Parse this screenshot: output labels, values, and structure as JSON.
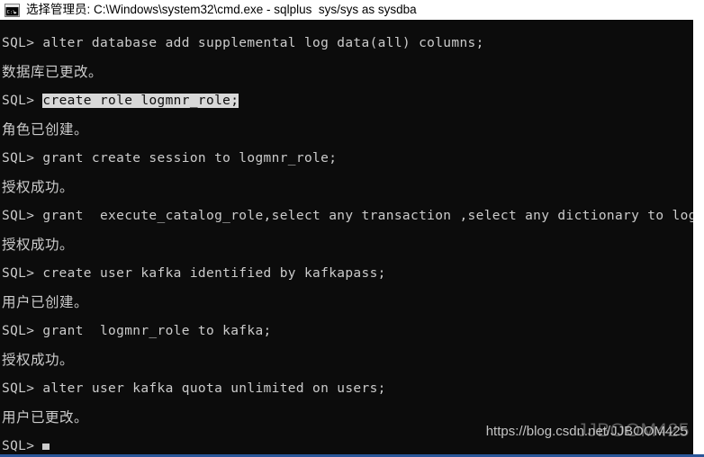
{
  "window": {
    "icon": "cmd-console-icon",
    "title": "选择管理员: C:\\Windows\\system32\\cmd.exe - sqlplus  sys/sys as sysdba",
    "background_color": "#0c0c0c",
    "foreground_color": "#cccccc",
    "titlebar_color": "#ffffff",
    "selection_background": "#d8d8d8",
    "selection_foreground": "#0c0c0c",
    "accent_color": "#2a5699"
  },
  "console": {
    "lines": [
      {
        "id": "l1",
        "kind": "command",
        "text": "SQL> alter database add supplemental log data(all) columns;"
      },
      {
        "id": "l2",
        "kind": "output",
        "text": "数据库已更改。"
      },
      {
        "id": "l3",
        "kind": "command",
        "prompt": "SQL> ",
        "selected": "create role logmnr_role;"
      },
      {
        "id": "l4",
        "kind": "output",
        "text": "角色已创建。"
      },
      {
        "id": "l5",
        "kind": "command",
        "text": "SQL> grant create session to logmnr_role;"
      },
      {
        "id": "l6",
        "kind": "output",
        "text": "授权成功。"
      },
      {
        "id": "l7",
        "kind": "command",
        "text": "SQL> grant  execute_catalog_role,select any transaction ,select any dictionary to logmnr_role;"
      },
      {
        "id": "l8",
        "kind": "output",
        "text": "授权成功。"
      },
      {
        "id": "l9",
        "kind": "command",
        "text": "SQL> create user kafka identified by kafkapass;"
      },
      {
        "id": "l10",
        "kind": "output",
        "text": "用户已创建。"
      },
      {
        "id": "l11",
        "kind": "command",
        "text": "SQL> grant  logmnr_role to kafka;"
      },
      {
        "id": "l12",
        "kind": "output",
        "text": "授权成功。"
      },
      {
        "id": "l13",
        "kind": "command",
        "text": "SQL> alter user kafka quota unlimited on users;"
      },
      {
        "id": "l14",
        "kind": "output",
        "text": "用户已更改。"
      },
      {
        "id": "l15",
        "kind": "prompt",
        "text": "SQL> "
      }
    ]
  },
  "watermark": {
    "url": "https://blog.csdn.net/JJBOOM425",
    "overlay": "JJBOOM425"
  }
}
